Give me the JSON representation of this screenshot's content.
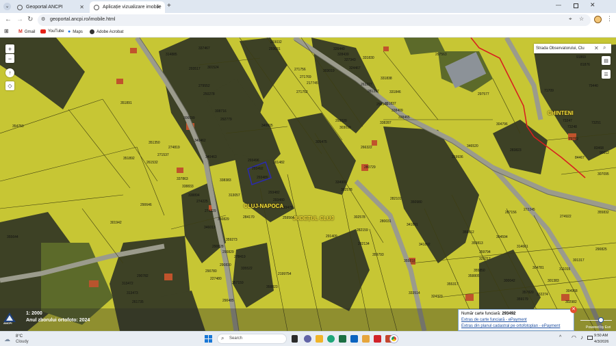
{
  "browser": {
    "tabs": [
      {
        "label": "Geoportal ANCPI",
        "active": false
      },
      {
        "label": "Aplicație vizualizare imobile",
        "active": true
      }
    ],
    "new_tab": "+",
    "url": "geoportal.ancpi.ro/imobile.html",
    "bookmarks": [
      "Gmail",
      "YouTube",
      "Maps",
      "Adobe Acrobat"
    ]
  },
  "map": {
    "search_value": "Strada Observatorului, Clu",
    "places": [
      "CLUJ-NAPOCA",
      "JUDEȚUL CLUJ",
      "CHINTENI"
    ],
    "scale": "1: 2000",
    "ortho_year": "Anul zborului ortofoto: 2024",
    "logo_text": "ANCPI",
    "attribution": "Powered by Esri",
    "popup": {
      "label": "Număr carte funciară:",
      "value": "293492",
      "link1": "Extras de carte funciară - ePayment",
      "link2": "Extras din planul cadastral pe ortofotoplan - ePayment"
    },
    "parcels": [
      "293032",
      "293031",
      "326440",
      "328439",
      "327343",
      "324467",
      "331830",
      "297563",
      "314885",
      "337467",
      "293517",
      "301524",
      "271756",
      "303019",
      "271769",
      "217745",
      "263227",
      "271752",
      "331838",
      "331846",
      "331837",
      "281317",
      "256941",
      "338409",
      "338465",
      "338287",
      "297577",
      "91869",
      "81876",
      "79440",
      "71709",
      "351891",
      "279552",
      "250278",
      "308716",
      "292779",
      "340605",
      "293020",
      "303019",
      "304796",
      "73247",
      "73248",
      "79782",
      "73251",
      "83468",
      "84467",
      "90012",
      "354750",
      "306099",
      "340462",
      "351350",
      "274819",
      "271537",
      "301482",
      "305475",
      "266322",
      "346520",
      "319936",
      "283823",
      "307095",
      "351892",
      "261532",
      "340463",
      "293496",
      "293492",
      "293489",
      "280729",
      "334991",
      "302578",
      "337863",
      "338833",
      "338894",
      "274225",
      "274229",
      "313057",
      "338383",
      "293482",
      "293480",
      "293479",
      "282101",
      "350980",
      "272245",
      "274922",
      "355832",
      "290646",
      "301942",
      "284170",
      "259564",
      "302578",
      "280031",
      "341891",
      "287156",
      "355644",
      "350829",
      "346013",
      "359273",
      "291409",
      "282159",
      "359812",
      "359813",
      "282134",
      "341892",
      "304594",
      "314661",
      "290825",
      "290828",
      "290829",
      "278419",
      "290830",
      "335522",
      "359793",
      "359794",
      "329217",
      "301317",
      "290782",
      "290780",
      "227480",
      "357159",
      "358823",
      "2199754",
      "355818",
      "355850",
      "358805",
      "300042",
      "304781",
      "311015",
      "313472",
      "313473",
      "261735",
      "290485",
      "333514",
      "324323",
      "355317",
      "357820",
      "359179",
      "332274",
      "301383",
      "304968",
      "302982"
    ]
  },
  "taskbar": {
    "weather_temp": "8°C",
    "weather_desc": "Cloudy",
    "search_label": "Search",
    "time": "9:50 AM",
    "date": "4/3/2026"
  },
  "colors": {
    "parcel_fill": "#c8c734",
    "parcel_stroke": "#3d3d10",
    "boundary": "#d81f1f",
    "place_text": "#f6e03a"
  }
}
